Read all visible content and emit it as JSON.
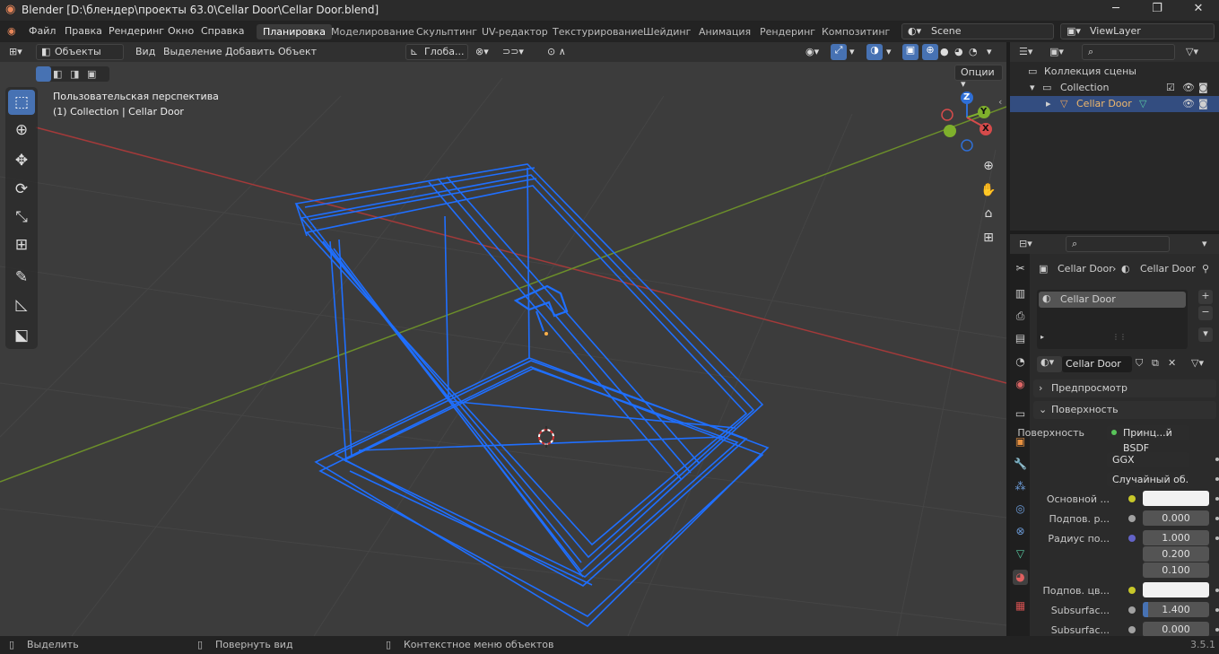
{
  "titlebar": {
    "title": "Blender [D:\\блендер\\проекты 63.0\\Cellar Door\\Cellar Door.blend]",
    "minimize": "─",
    "maximize": "❐",
    "close": "✕"
  },
  "menu": {
    "items": [
      "Файл",
      "Правка",
      "Рендеринг",
      "Окно",
      "Справка"
    ],
    "workspaces": [
      "Планировка",
      "Моделирование",
      "Скульптинг",
      "UV-редактор",
      "Текстурирование",
      "Шейдинг",
      "Анимация",
      "Рендеринг",
      "Композитинг"
    ],
    "active_workspace": "Планировка",
    "scene": "Scene",
    "view_layer": "ViewLayer"
  },
  "viewport": {
    "mode": "Объекты",
    "menus": [
      "Вид",
      "Выделение",
      "Добавить",
      "Объект"
    ],
    "orientation": "Глоба...",
    "options": "Опции",
    "overlay_title": "Пользовательская перспектива",
    "overlay_subtitle": "(1) Collection | Cellar Door",
    "gizmo": {
      "z": "Z",
      "y": "Y",
      "x": "X"
    }
  },
  "outliner": {
    "scene_collection": "Коллекция сцены",
    "collection": "Collection",
    "object": "Cellar Door"
  },
  "properties": {
    "breadcrumb": [
      "Cellar Door",
      "Cellar Door"
    ],
    "material_slot": "Cellar Door",
    "material_name": "Cellar Door",
    "panels": {
      "preview": "Предпросмотр",
      "surface": "Поверхность"
    },
    "surface_label": "Поверхность",
    "surface_value": "Принц...й BSDF",
    "distribution": "GGX",
    "subsurface_method": "Случайный об...",
    "rows": [
      {
        "label": "Основной ...",
        "value": "",
        "kind": "color"
      },
      {
        "label": "Подпов. р...",
        "value": "0.000"
      },
      {
        "label": "Радиус по...",
        "value": "1.000"
      },
      {
        "label": "",
        "value": "0.200"
      },
      {
        "label": "",
        "value": "0.100"
      },
      {
        "label": "Подпов. цв...",
        "value": "",
        "kind": "color"
      },
      {
        "label": "Subsurfac...",
        "value": "1.400"
      },
      {
        "label": "Subsurfac...",
        "value": "0.000"
      }
    ]
  },
  "statusbar": {
    "select": "Выделить",
    "rotate": "Повернуть вид",
    "context": "Контекстное меню объектов",
    "version": "3.5.1"
  },
  "colors": {
    "accent": "#4772b3",
    "wire": "#1f6fff",
    "x_axis": "#a33a3a",
    "y_axis": "#6c8f2a",
    "viewport_bg": "#3c3c3c"
  }
}
